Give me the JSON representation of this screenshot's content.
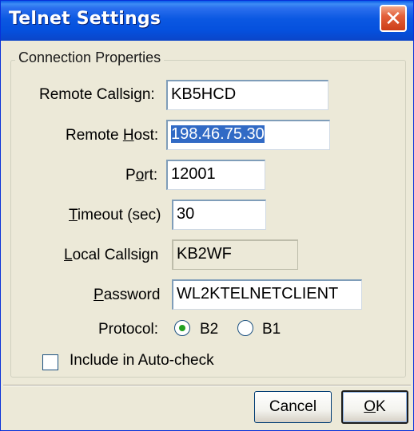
{
  "window": {
    "title": "Telnet Settings",
    "close_glyph": "✕"
  },
  "group": {
    "legend": "Connection Properties"
  },
  "fields": {
    "remote_callsign": {
      "label": "Remote Callsign:",
      "value": "KB5HCD"
    },
    "remote_host": {
      "label_pre": "Remote ",
      "label_u": "H",
      "label_post": "ost:",
      "value": "198.46.75.30"
    },
    "port": {
      "label_pre": "P",
      "label_u": "o",
      "label_post": "rt:",
      "value": "12001"
    },
    "timeout": {
      "label_u": "T",
      "label_post": "imeout (sec)",
      "value": "30"
    },
    "local_callsign": {
      "label_u": "L",
      "label_post": "ocal Callsign",
      "value": "KB2WF"
    },
    "password": {
      "label_u": "P",
      "label_post": "assword",
      "value": "WL2KTELNETCLIENT"
    }
  },
  "protocol": {
    "label": "Protocol:",
    "options": [
      {
        "label": "B2",
        "selected": true
      },
      {
        "label": "B1",
        "selected": false
      }
    ]
  },
  "autocheck": {
    "label": "Include in Auto-check",
    "checked": false
  },
  "buttons": {
    "cancel": "Cancel",
    "ok_u": "O",
    "ok_post": "K"
  },
  "colors": {
    "titlebar": "#0b58e2",
    "dialog_bg": "#ece9d8",
    "selection": "#316ac5",
    "close_button": "#e3603a"
  }
}
